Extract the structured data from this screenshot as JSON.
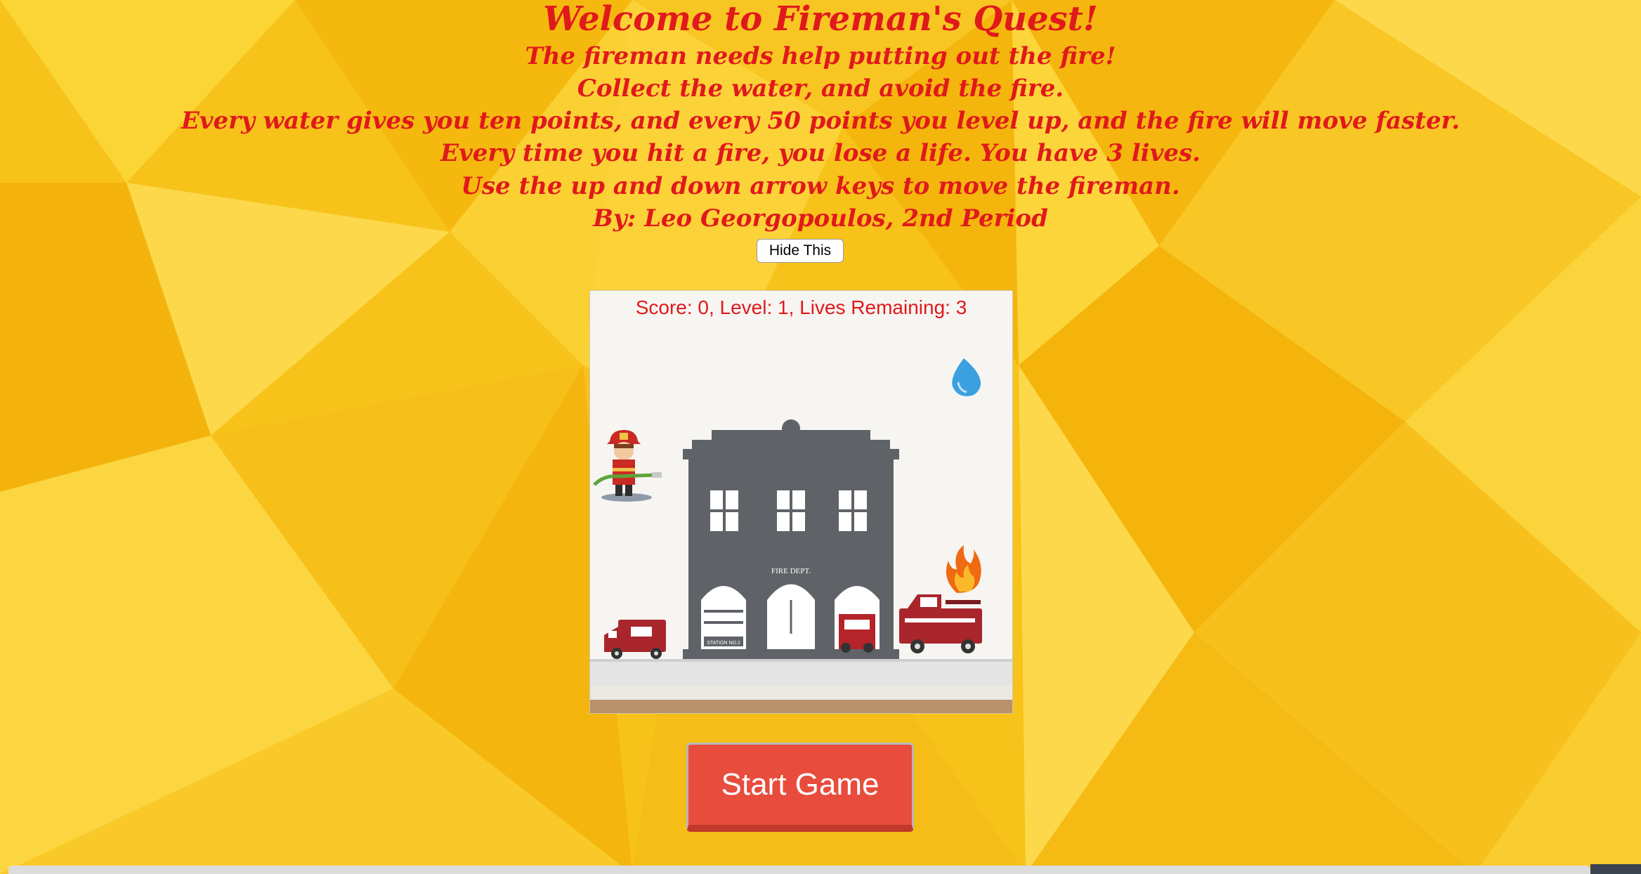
{
  "intro": {
    "title": "Welcome to Fireman's Quest!",
    "lines": [
      "The fireman needs help putting out the fire!",
      "Collect the water, and avoid the fire.",
      "Every water gives you ten points, and every 50 points you level up, and the fire will move faster.",
      "Every time you hit a fire, you lose a life. You have 3 lives.",
      "Use the up and down arrow keys to move the fireman.",
      "By: Leo Georgopoulos, 2nd Period"
    ],
    "hide_button": "Hide This"
  },
  "game": {
    "score_text": "Score: 0, Level: 1, Lives Remaining: 3",
    "station_sign": "FIRE DEPT.",
    "station_plate": "STATION NO.2",
    "sprites": [
      "fireman",
      "water-drop",
      "fire",
      "fire-station",
      "fire-truck",
      "ambulance"
    ]
  },
  "start_button": "Start Game",
  "colors": {
    "text_red": "#e0191b",
    "background_yellow": "#f7c21a",
    "start_button": "#e84c3d",
    "station_gray": "#5f6368"
  }
}
